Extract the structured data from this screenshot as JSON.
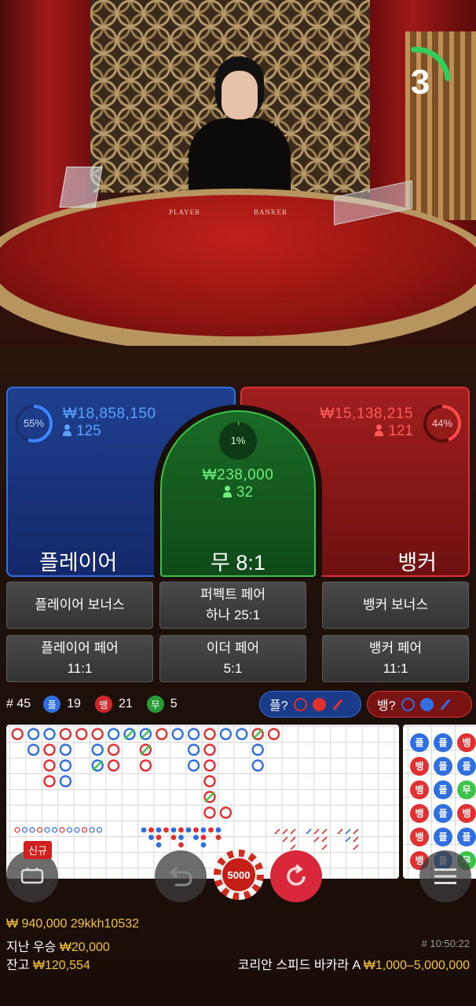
{
  "video": {
    "table_labels": [
      "PLAYER",
      "BANKER"
    ],
    "countdown": "3",
    "countdown_progress": 0.25
  },
  "bets": {
    "player": {
      "percent": "55%",
      "percent_value": 0.55,
      "amount": "₩18,858,150",
      "players": "125",
      "label": "플레이어"
    },
    "banker": {
      "percent": "44%",
      "percent_value": 0.44,
      "amount": "₩15,138,215",
      "players": "121",
      "label": "뱅커"
    },
    "tie": {
      "percent": "1%",
      "percent_value": 0.01,
      "amount": "₩238,000",
      "players": "32",
      "label": "무 8:1"
    }
  },
  "side_bets": [
    {
      "line1": "플레이어 보너스",
      "line2": ""
    },
    {
      "line1": "퍼펙트 페어",
      "line2": "하나 25:1"
    },
    {
      "line1": "뱅커 보너스",
      "line2": ""
    },
    {
      "line1": "플레이어 페어",
      "line2": "11:1"
    },
    {
      "line1": "이더 페어",
      "line2": "5:1"
    },
    {
      "line1": "뱅커 페어",
      "line2": "11:1"
    }
  ],
  "stats": {
    "rounds": "# 45",
    "player_short": "플",
    "player_count": "19",
    "banker_short": "뱅",
    "banker_count": "21",
    "tie_short": "무",
    "tie_count": "5",
    "player_ask": "플?",
    "banker_ask": "뱅?"
  },
  "colors": {
    "player": "#2f6fe0",
    "banker": "#e03030",
    "tie": "#3cc34a",
    "gold": "#f2c437"
  },
  "roadmap": {
    "big_road": [
      [
        "B",
        "P",
        "P",
        "B",
        "B",
        "B",
        "P",
        "Pt",
        "Pt",
        "B",
        "P",
        "P",
        "B",
        "P",
        "P",
        "Bt",
        "B"
      ],
      [
        "",
        "P",
        "B",
        "P",
        "",
        "P",
        "B",
        "",
        "Bt",
        "",
        "",
        "P",
        "B",
        "",
        "",
        "P",
        ""
      ],
      [
        "",
        "",
        "B",
        "P",
        "",
        "Pt",
        "B",
        "",
        "B",
        "",
        "",
        "P",
        "B",
        "",
        "",
        "P",
        ""
      ],
      [
        "",
        "",
        "B",
        "P",
        "",
        "",
        "",
        "",
        "",
        "",
        "",
        "",
        "B",
        "",
        "",
        "",
        ""
      ],
      [
        "",
        "",
        "",
        "",
        "",
        "",
        "",
        "",
        "",
        "",
        "",
        "",
        "Bt",
        "",
        "",
        "",
        ""
      ],
      [
        "",
        "",
        "",
        "",
        "",
        "",
        "",
        "",
        "",
        "",
        "",
        "",
        "B",
        "B",
        "",
        "",
        ""
      ]
    ],
    "bead_road": [
      "플",
      "뱅",
      "뱅",
      "뱅",
      "뱅",
      "뱅",
      "플",
      "플",
      "플",
      "플",
      "플",
      "플",
      "뱅",
      "플",
      "무",
      "뱅",
      "플",
      "무"
    ]
  },
  "controls": {
    "new_badge": "신규",
    "chip_value": "5000"
  },
  "footer": {
    "balance_line": "₩ 940,000 29kkh10532",
    "last_win_label": "지난 우승",
    "last_win_amount": "₩20,000",
    "balance_label": "잔고",
    "balance_amount": "₩120,554",
    "round_id": "# 10:50:22",
    "table_name": "코리안 스피드 바카라 A",
    "limits": "₩1,000–5,000,000"
  }
}
